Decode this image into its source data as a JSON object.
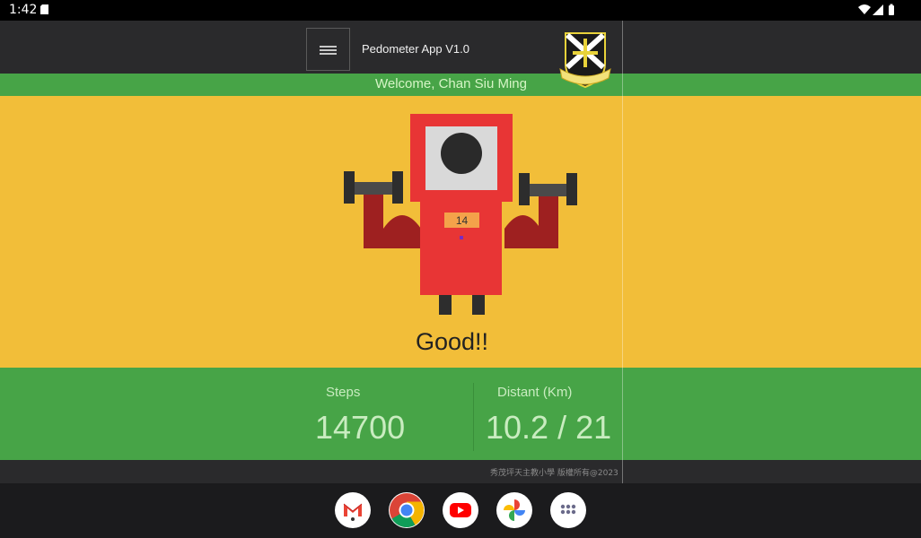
{
  "status_bar": {
    "time": "1:42"
  },
  "app": {
    "title": "Pedometer App V1.0",
    "welcome": "Welcome, Chan Siu Ming",
    "badge_number": "14",
    "rating": "Good!!",
    "stats": {
      "steps_label": "Steps",
      "steps_value": "14700",
      "distance_label": "Distant (Km)",
      "distance_value": "10.2 / 21"
    },
    "copyright": "秀茂坪天主教小學 版權所有@2023"
  },
  "colors": {
    "header_bg": "#2a2a2c",
    "green": "#47a447",
    "yellow": "#f2be39",
    "robot_red": "#e83535",
    "robot_dark_red": "#9e2020"
  },
  "dock": {
    "apps": [
      "gmail-icon",
      "chrome-icon",
      "youtube-icon",
      "photos-icon",
      "app-drawer-icon"
    ]
  }
}
